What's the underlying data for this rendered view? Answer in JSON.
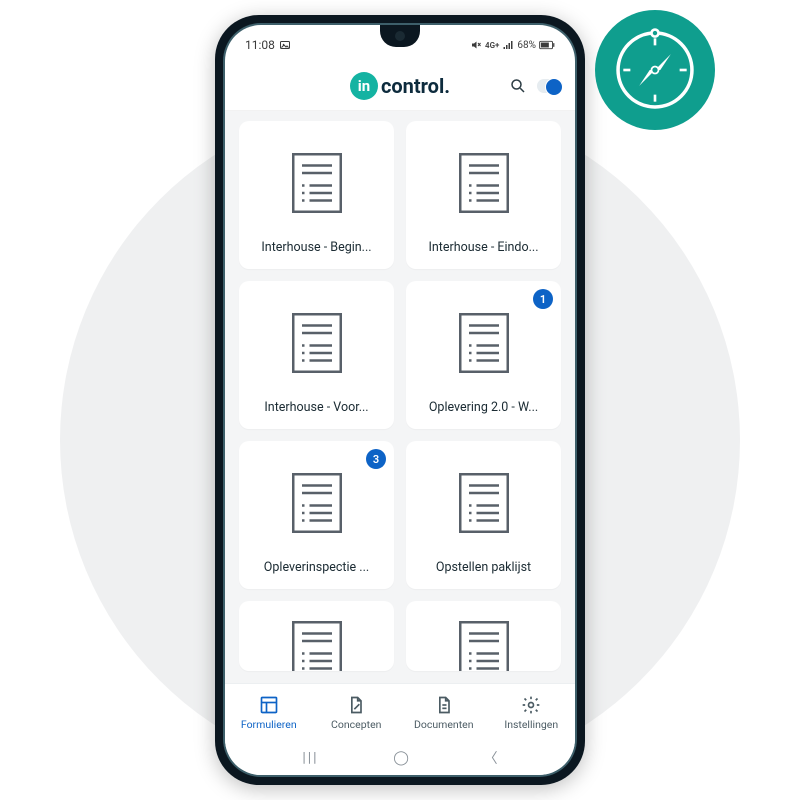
{
  "status": {
    "time": "11:08",
    "network_label": "4G+",
    "battery": "68%"
  },
  "brand": {
    "bubble_text": "in",
    "wordmark": "control."
  },
  "tiles": [
    {
      "label": "Interhouse - Begin...",
      "badge": null
    },
    {
      "label": "Interhouse - Eindo...",
      "badge": null
    },
    {
      "label": "Interhouse - Voor...",
      "badge": null
    },
    {
      "label": "Oplevering 2.0 - W...",
      "badge": "1"
    },
    {
      "label": "Opleverinspectie ...",
      "badge": "3"
    },
    {
      "label": "Opstellen paklijst",
      "badge": null
    }
  ],
  "nav": {
    "formulieren": "Formulieren",
    "concepten": "Concepten",
    "documenten": "Documenten",
    "instellingen": "Instellingen"
  },
  "sysnav": {
    "recent": "|||",
    "home": "◯",
    "back": "〈"
  }
}
